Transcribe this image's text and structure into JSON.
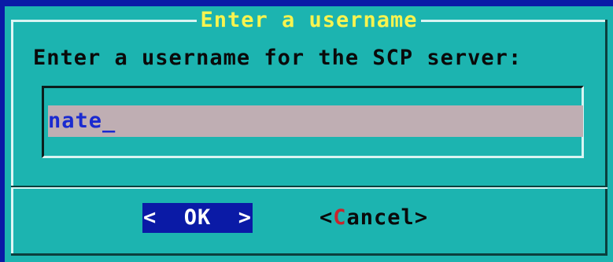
{
  "dialog": {
    "title": "Enter a username",
    "prompt": "Enter a username for the SCP server:",
    "input_value": "nate_"
  },
  "buttons": {
    "ok_label": "<  OK  >",
    "cancel_open": "<",
    "cancel_hotkey": "C",
    "cancel_rest": "ancel",
    "cancel_close": ">"
  },
  "colors": {
    "screen_bg": "#0a1aa6",
    "dialog_bg": "#1cb4b0",
    "title": "#f7f44f",
    "input_bg": "#bfaeb3",
    "input_text": "#1a2ad0",
    "hotkey": "#c8242c"
  }
}
